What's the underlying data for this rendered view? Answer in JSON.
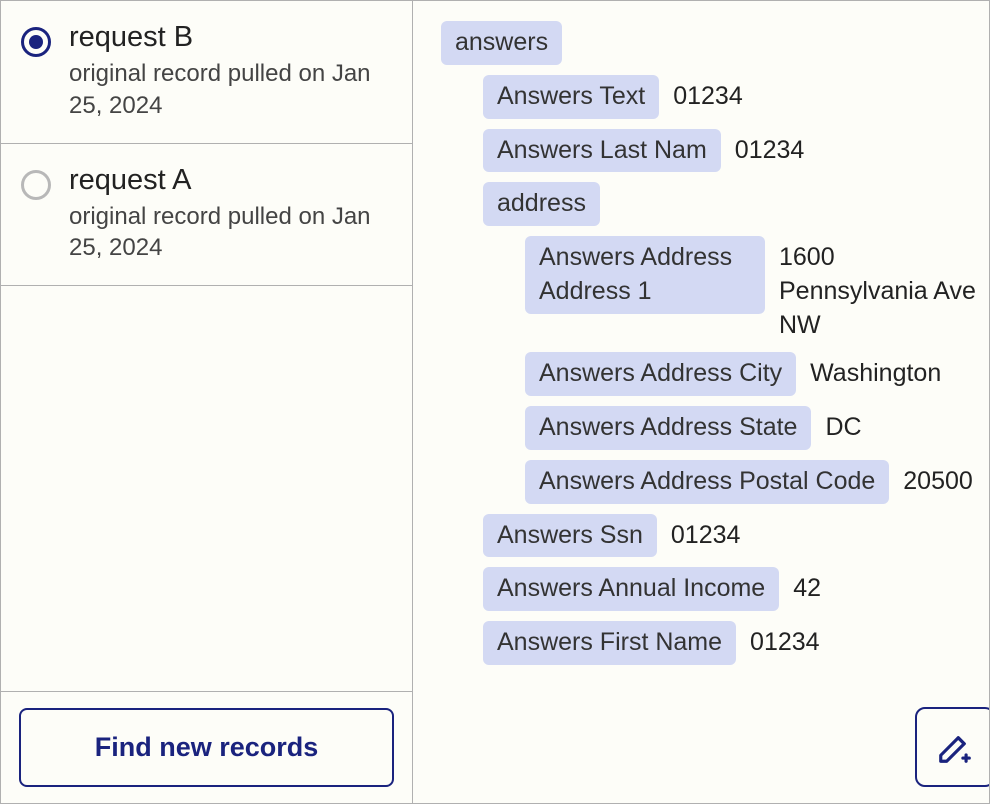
{
  "sidebar": {
    "items": [
      {
        "title": "request B",
        "subtitle": "original record pulled on Jan 25, 2024",
        "selected": true
      },
      {
        "title": "request A",
        "subtitle": "original record pulled on Jan 25, 2024",
        "selected": false
      }
    ],
    "find_button": "Find new records"
  },
  "tree": {
    "root": "answers",
    "answers_text_label": "Answers Text",
    "answers_text_value": "01234",
    "answers_last_nam_label": "Answers Last Nam",
    "answers_last_nam_value": "01234",
    "address_label": "address",
    "address1_label": "Answers Address Address 1",
    "address1_value": "1600 Pennsylvania Ave NW",
    "city_label": "Answers Address City",
    "city_value": "Washington",
    "state_label": "Answers Address State",
    "state_value": "DC",
    "postal_label": "Answers Address Postal Code",
    "postal_value": "20500",
    "ssn_label": "Answers Ssn",
    "ssn_value": "01234",
    "income_label": "Answers Annual Income",
    "income_value": "42",
    "first_name_label": "Answers First Name",
    "first_name_value": "01234"
  }
}
